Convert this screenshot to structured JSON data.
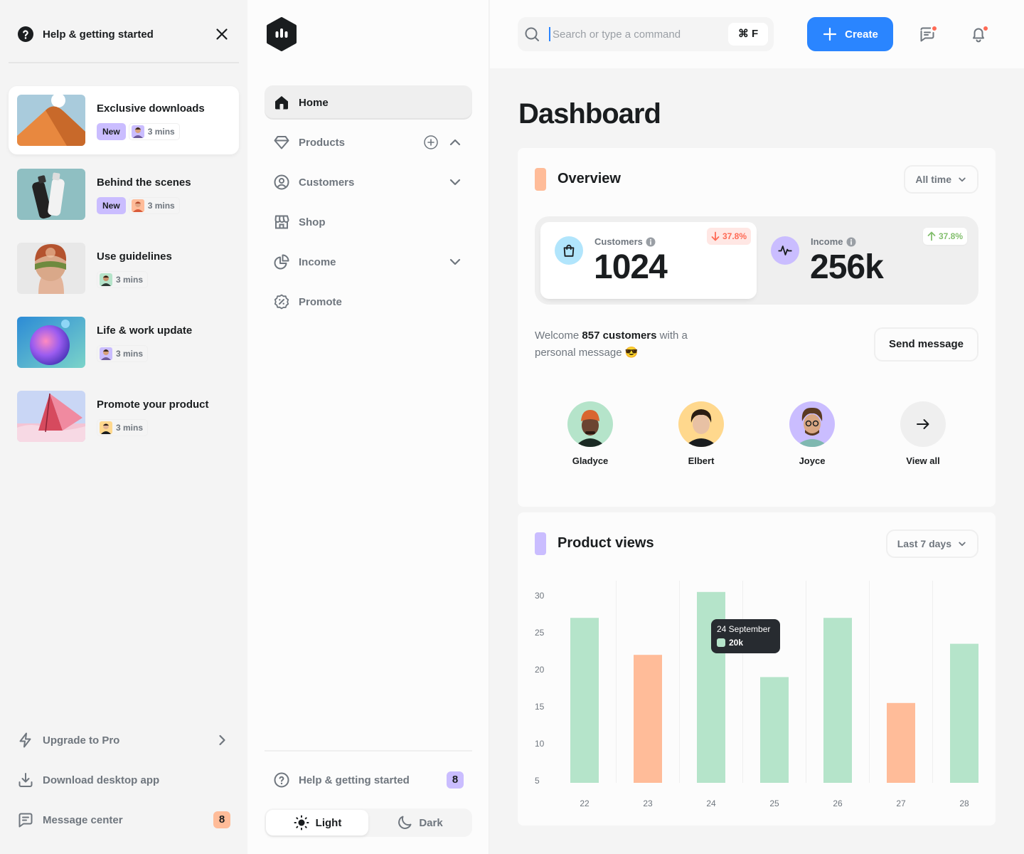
{
  "help_panel": {
    "title": "Help & getting started",
    "cards": [
      {
        "title": "Exclusive downloads",
        "badge": "New",
        "duration": "3 mins",
        "active": true
      },
      {
        "title": "Behind the scenes",
        "badge": "New",
        "duration": "3 mins",
        "active": false
      },
      {
        "title": "Use guidelines",
        "badge": "",
        "duration": "3 mins",
        "active": false
      },
      {
        "title": "Life & work update",
        "badge": "",
        "duration": "3 mins",
        "active": false
      },
      {
        "title": "Promote your product",
        "badge": "",
        "duration": "3 mins",
        "active": false
      }
    ],
    "footer": {
      "upgrade": "Upgrade to Pro",
      "download": "Download desktop app",
      "messages": "Message center",
      "messages_count": "8"
    }
  },
  "nav": {
    "items": [
      {
        "label": "Home",
        "icon": "home-icon",
        "active": true
      },
      {
        "label": "Products",
        "icon": "diamond-icon"
      },
      {
        "label": "Customers",
        "icon": "profile-circle-icon"
      },
      {
        "label": "Shop",
        "icon": "store-icon"
      },
      {
        "label": "Income",
        "icon": "pie-chart-icon"
      },
      {
        "label": "Promote",
        "icon": "promotion-icon"
      }
    ],
    "help_label": "Help & getting started",
    "help_count": "8",
    "theme": {
      "light": "Light",
      "dark": "Dark",
      "selected": "Light"
    }
  },
  "header": {
    "search_placeholder": "Search or type a command",
    "shortcut": "⌘ F",
    "create_label": "Create"
  },
  "page": {
    "title": "Dashboard"
  },
  "overview": {
    "title": "Overview",
    "range": "All time",
    "stats": [
      {
        "label": "Customers",
        "value": "1024",
        "change": "37.8%",
        "direction": "down"
      },
      {
        "label": "Income",
        "value": "256k",
        "change": "37.8%",
        "direction": "up"
      }
    ],
    "welcome_pre": "Welcome ",
    "welcome_strong": "857 customers",
    "welcome_post": " with a personal message 😎",
    "send_label": "Send message",
    "people": [
      "Gladyce",
      "Elbert",
      "Joyce"
    ],
    "view_all": "View all"
  },
  "product_views": {
    "title": "Product views",
    "range": "Last 7 days",
    "tooltip": {
      "date": "24 September",
      "value": "20k"
    }
  },
  "colors": {
    "accent_blue": "#2a85ff",
    "green_bar": "#b5e4ca",
    "orange_bar": "#ffbc99",
    "purple": "#cabdff",
    "red": "#ff6a55",
    "green": "#83bf6e"
  },
  "chart_data": {
    "type": "bar",
    "title": "Product views",
    "categories": [
      "22",
      "23",
      "24",
      "25",
      "26",
      "27",
      "28"
    ],
    "values": [
      27,
      22,
      30.5,
      19,
      27,
      15.5,
      23.5
    ],
    "bar_colors": [
      "#b5e4ca",
      "#ffbc99",
      "#b5e4ca",
      "#b5e4ca",
      "#b5e4ca",
      "#ffbc99",
      "#b5e4ca"
    ],
    "y_ticks": [
      "5",
      "10",
      "15",
      "20",
      "25",
      "30"
    ],
    "ylim": [
      5,
      30
    ],
    "grid": "vertical"
  }
}
